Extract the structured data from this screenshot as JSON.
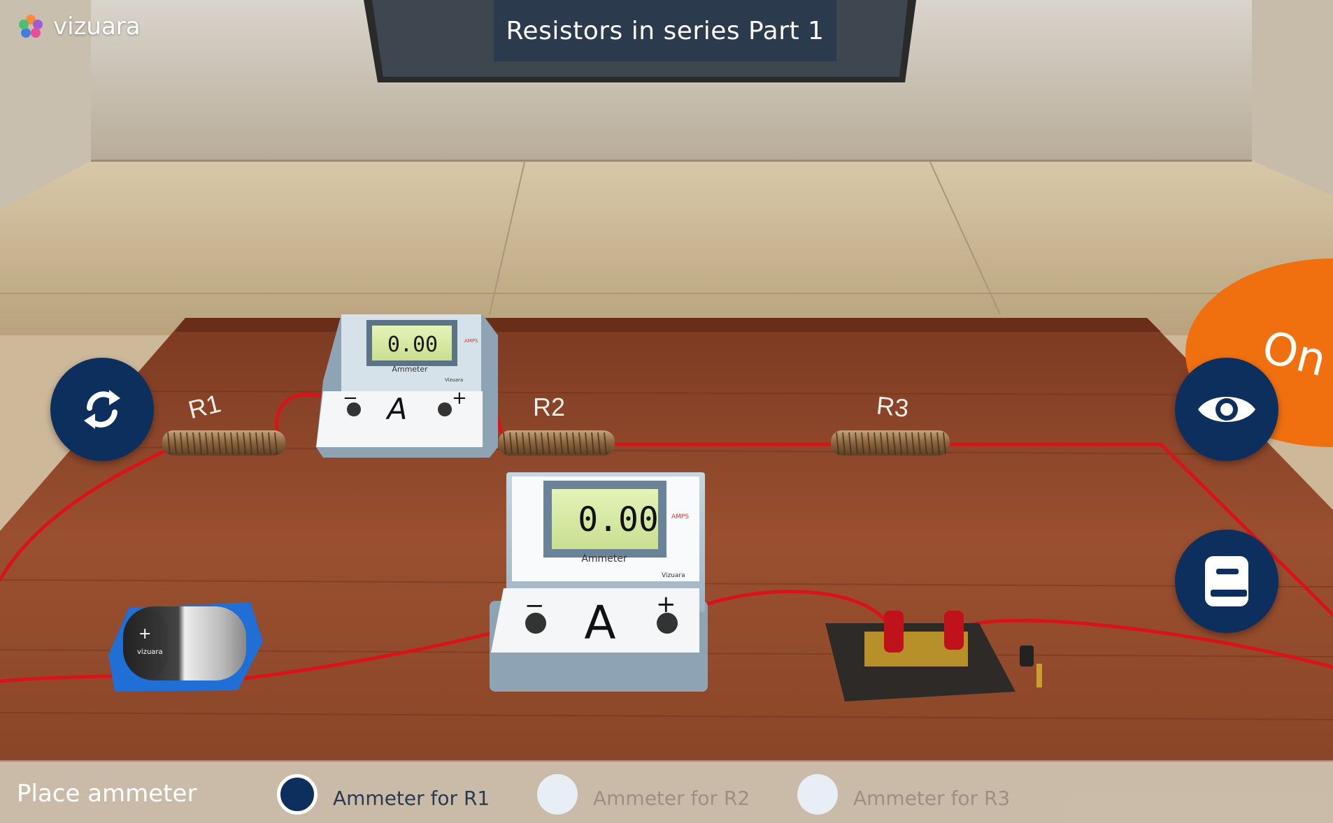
{
  "app": {
    "brand": "vizuara",
    "title": "Resistors in series Part 1"
  },
  "scene": {
    "resistor_labels": [
      "R1",
      "R2",
      "R3"
    ],
    "ammeter_small": {
      "reading": "0.00",
      "label": "Ammeter",
      "unit": "AMPS",
      "brand": "Vizuara",
      "minus": "−",
      "symbol": "A",
      "plus": "+"
    },
    "ammeter_large": {
      "reading": "0.00",
      "label": "Ammeter",
      "unit": "AMPS",
      "brand": "Vizuara",
      "minus": "−",
      "symbol": "A",
      "plus": "+"
    },
    "battery": {
      "plus": "+",
      "brand": "vizuara"
    }
  },
  "side_buttons": {
    "left": "reset-icon",
    "right_top": "eye-icon",
    "right_bottom": "notebook-icon"
  },
  "orange_button": {
    "label": "On"
  },
  "bottom": {
    "instruction": "Place ammeter",
    "options": [
      {
        "label": "Ammeter for R1",
        "selected": true
      },
      {
        "label": "Ammeter for R2",
        "selected": false
      },
      {
        "label": "Ammeter for R3",
        "selected": false
      }
    ]
  },
  "colors": {
    "accent": "#0d2f5e",
    "orange": "#f0700f",
    "wire": "#d8141a",
    "table": "#8a4426"
  }
}
